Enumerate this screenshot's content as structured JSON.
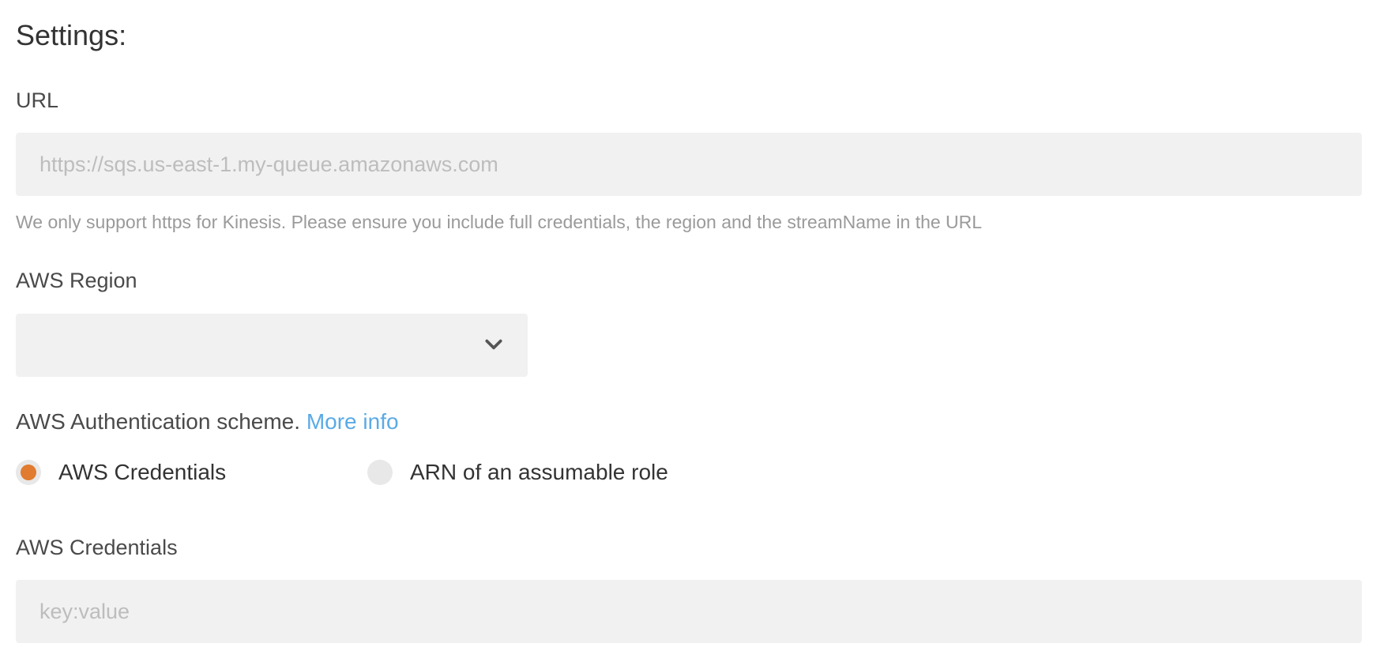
{
  "settings": {
    "title": "Settings:"
  },
  "url_field": {
    "label": "URL",
    "value": "",
    "placeholder": "https://sqs.us-east-1.my-queue.amazonaws.com",
    "help": "We only support https for Kinesis. Please ensure you include full credentials, the region and the streamName in the URL"
  },
  "region_field": {
    "label": "AWS Region",
    "selected": "",
    "icon": "chevron-down-icon"
  },
  "auth": {
    "label": "AWS Authentication scheme.",
    "more_info": "More info",
    "link_color": "#5aaae6",
    "options": [
      {
        "label": "AWS Credentials",
        "checked": true
      },
      {
        "label": "ARN of an assumable role",
        "checked": false
      }
    ],
    "accent_color": "#e07b2f"
  },
  "credentials_field": {
    "label": "AWS Credentials",
    "value": "",
    "placeholder": "key:value"
  }
}
